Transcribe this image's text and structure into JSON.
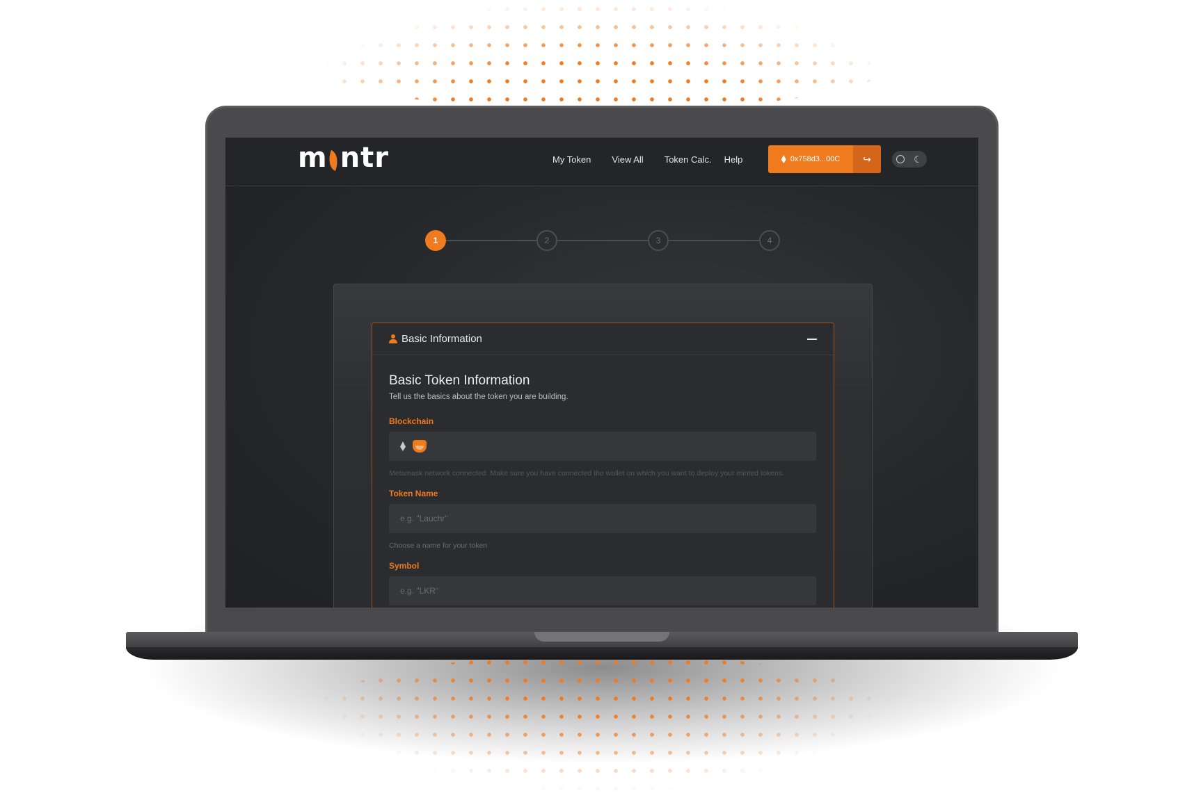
{
  "brand": {
    "logo_text_a": "m",
    "logo_text_b": "ntr",
    "accent": "#f07a1e"
  },
  "nav": {
    "links": [
      "My Token",
      "View All",
      "Token Calc.",
      "Help"
    ],
    "wallet_address": "0x758d3...00C",
    "wallet_icon": "ethereum-icon",
    "exit_icon": "logout-icon",
    "theme_icons": [
      "sun-icon",
      "moon-icon"
    ]
  },
  "stepper": {
    "steps": [
      "1",
      "2",
      "3",
      "4"
    ],
    "active": 1
  },
  "panel": {
    "title": "Basic Information",
    "icon": "person-icon",
    "heading": "Basic Token Information",
    "subheading": "Tell us the basics about the token you are building.",
    "blockchain": {
      "label": "Blockchain",
      "icons": [
        "ethereum-icon",
        "metamask-fox-icon"
      ],
      "hint": "Metamask network connected. Make sure you have connected the wallet on which you want to deploy your minted tokens."
    },
    "token_name": {
      "label": "Token Name",
      "placeholder": "e.g. \"Lauchr\"",
      "hint": "Choose a name for your token"
    },
    "symbol": {
      "label": "Symbol",
      "placeholder": "e.g. \"LKR\""
    }
  }
}
